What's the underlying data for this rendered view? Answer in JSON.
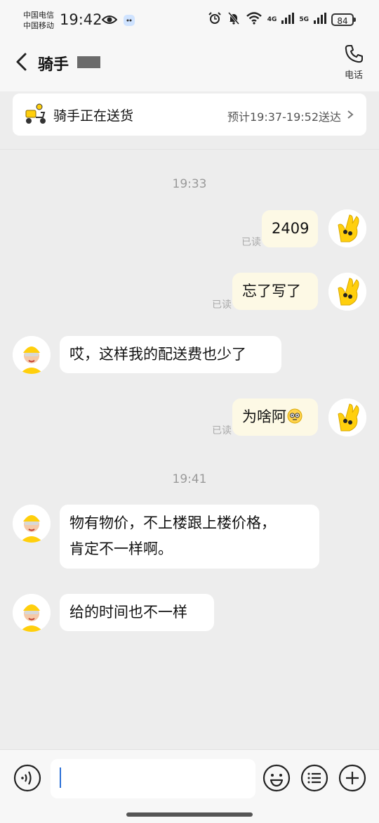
{
  "status": {
    "carrier1": "中国电信",
    "carrier2": "中国移动",
    "time": "19:42",
    "net1": "4G",
    "net2": "5G",
    "battery": "84"
  },
  "header": {
    "title": "骑手",
    "phone_label": "电话"
  },
  "delivery": {
    "status": "骑手正在送货",
    "eta": "预计19:37-19:52送达"
  },
  "chat": {
    "timestamp1": "19:33",
    "timestamp2": "19:41",
    "read_label": "已读",
    "messages": [
      {
        "from": "me",
        "text": "2409",
        "read": true
      },
      {
        "from": "me",
        "text": "忘了写了",
        "read": true
      },
      {
        "from": "rider",
        "text": "哎，这样我的配送费也少了"
      },
      {
        "from": "me",
        "text": "为啥阿",
        "read": true
      },
      {
        "from": "rider",
        "text_line1": "物有物价，不上楼跟上楼价格，",
        "text_line2": "肯定不一样啊。"
      },
      {
        "from": "rider",
        "text": "给的时间也不一样"
      }
    ]
  },
  "colors": {
    "my_bubble": "#fdf9e5",
    "rider_bubble": "#ffffff",
    "background": "#ededed",
    "accent_yellow": "#ffcf0d"
  }
}
